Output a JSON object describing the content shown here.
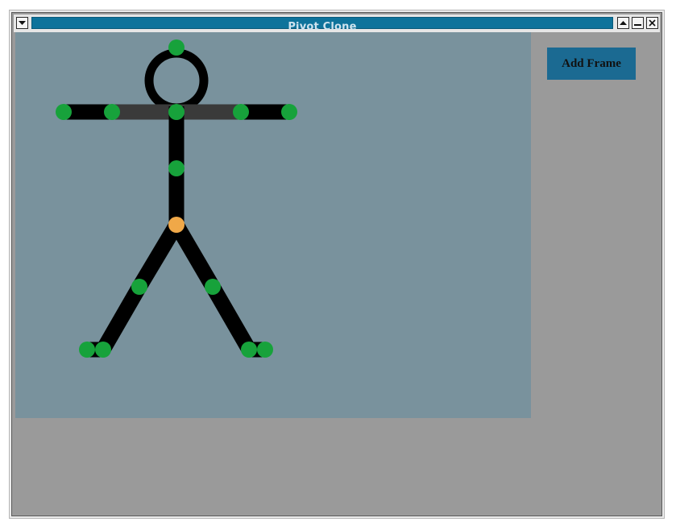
{
  "window": {
    "title": "Pivot Clone"
  },
  "toolbar": {
    "add_frame_label": "Add Frame"
  },
  "colors": {
    "title_bar": "#0e739b",
    "canvas_bg": "#79929d",
    "window_bg": "#9a9a9a",
    "joint_handle": "#17a23b",
    "root_handle": "#f0a848",
    "limb": "#000000",
    "arm_segment": "#3a3a3a",
    "button_bg": "#1b6a92"
  },
  "icons": {
    "menu": "chevron-down-icon",
    "shade": "triangle-up-icon",
    "minimize": "minimize-icon",
    "close": "close-icon"
  }
}
